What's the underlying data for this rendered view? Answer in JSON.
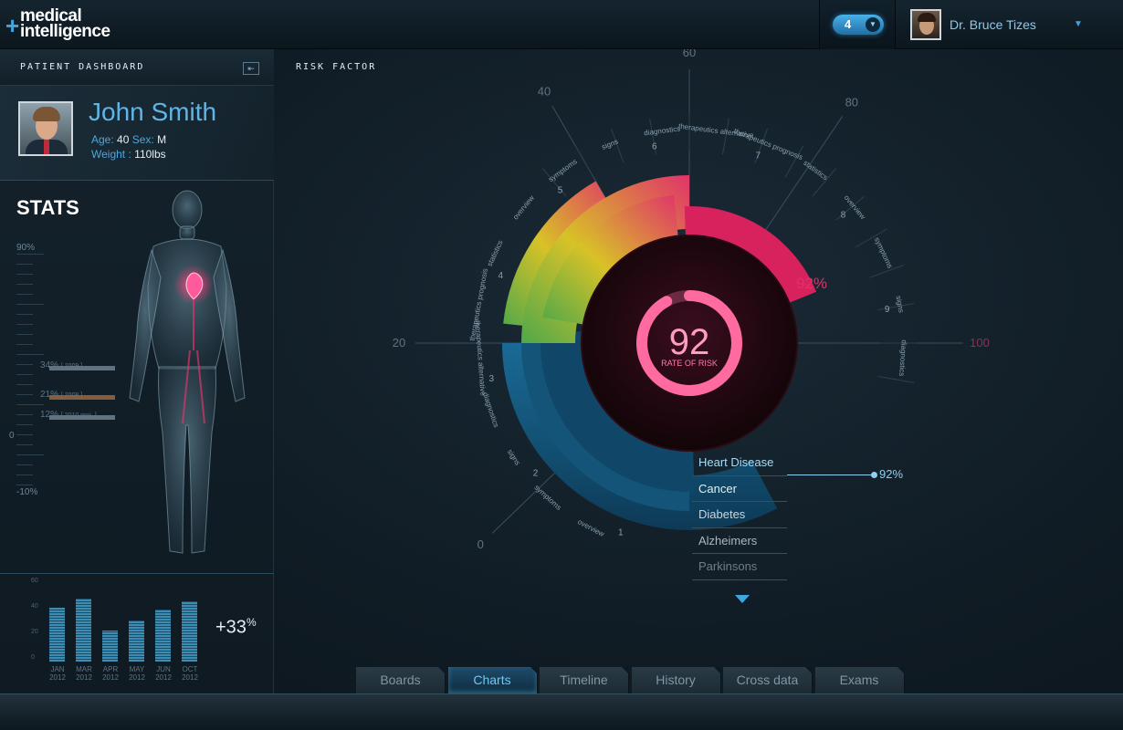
{
  "app": {
    "logo_line1": "medical",
    "logo_line2": "intelligence",
    "logo_plus": "+"
  },
  "notifications": {
    "count": "4"
  },
  "user": {
    "name": "Dr. Bruce Tizes"
  },
  "left_panel": {
    "title": "PATIENT DASHBOARD",
    "patient": {
      "name": "John Smith",
      "age_label": "Age:",
      "age": "40",
      "sex_label": "Sex:",
      "sex": "M",
      "weight_label": "Weight :",
      "weight": "110lbs"
    },
    "stats_title": "STATS",
    "scale": {
      "top": "90%",
      "zero": "0",
      "bottom": "-10%"
    },
    "stats": [
      {
        "value": "34%",
        "year": "[ 2009 ]",
        "level": 34,
        "color": "#5f7480"
      },
      {
        "value": "21%",
        "year": "[ 2008 ]",
        "level": 21,
        "color": "#8a5a3a"
      },
      {
        "value": "12%",
        "year": "[ 2010 proj. ]",
        "level": 12,
        "color": "#5f7480"
      }
    ],
    "monthly": {
      "y_ticks": [
        "60",
        "40",
        "20",
        "0"
      ],
      "months": [
        {
          "m": "JAN",
          "y": "2012",
          "v": 42
        },
        {
          "m": "MAR",
          "y": "2012",
          "v": 49
        },
        {
          "m": "APR",
          "y": "2012",
          "v": 24
        },
        {
          "m": "MAY",
          "y": "2012",
          "v": 32
        },
        {
          "m": "JUN",
          "y": "2012",
          "v": 41
        },
        {
          "m": "OCT",
          "y": "2012",
          "v": 47
        }
      ],
      "growth": "+33",
      "growth_unit": "%"
    }
  },
  "main": {
    "title": "RISK FACTOR",
    "gauge": {
      "value": "92",
      "label": "RATE OF RISK",
      "percent": 92,
      "percent_label": "92%"
    },
    "axis_labels": {
      "top": "60",
      "left": "20",
      "right": "100",
      "top_left": "40",
      "top_right": "80",
      "bottom_left": "0"
    },
    "segment_numbers": [
      "1",
      "2",
      "3",
      "4",
      "5",
      "6",
      "7",
      "8",
      "9"
    ],
    "ring_labels": [
      "overview",
      "symptoms",
      "signs",
      "diagnostics",
      "therapeutics alternative",
      "therapeutics prognosis",
      "statistics",
      "overview",
      "symptoms",
      "signs",
      "diagnostics",
      "therapeutics alternative",
      "therapeutics prognosis",
      "statistics",
      "overview",
      "symptoms",
      "signs",
      "diagnostics"
    ],
    "diseases": [
      {
        "name": "Heart Disease",
        "active": true
      },
      {
        "name": "Cancer",
        "active": false
      },
      {
        "name": "Diabetes",
        "active": false
      },
      {
        "name": "Alzheimers",
        "active": false
      },
      {
        "name": "Parkinsons",
        "active": false
      }
    ],
    "selected_value": "92%"
  },
  "tabs": [
    {
      "label": "Boards",
      "active": false
    },
    {
      "label": "Charts",
      "active": true
    },
    {
      "label": "Timeline",
      "active": false
    },
    {
      "label": "History",
      "active": false
    },
    {
      "label": "Cross data",
      "active": false
    },
    {
      "label": "Exams",
      "active": false
    }
  ],
  "colors": {
    "accent": "#3fa7e0",
    "risk": "#e0336a",
    "ring_blue": "#1a5e86"
  }
}
